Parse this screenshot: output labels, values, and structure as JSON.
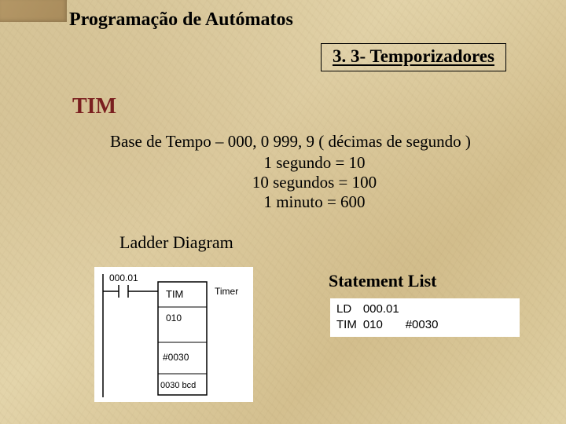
{
  "header": {
    "title": "Programação de Autómatos",
    "subtitle": "3. 3- Temporizadores"
  },
  "section": {
    "mnemonic": "TIM"
  },
  "base": {
    "line1": "Base de Tempo – 000, 0  999, 9 ( décimas de segundo )",
    "line2": "1 segundo = 10",
    "line3": "10 segundos = 100",
    "line4": "1 minuto = 600"
  },
  "labels": {
    "ladder": "Ladder Diagram",
    "statement_list": "Statement List"
  },
  "ladder": {
    "contact": "000.01",
    "block_title": "TIM",
    "annotation": "Timer",
    "row1": "010",
    "row2": "#0030",
    "row3": "0030 bcd"
  },
  "stlist": {
    "rows": [
      {
        "c0": "LD",
        "c1": "000.01",
        "c2": ""
      },
      {
        "c0": "TIM",
        "c1": "010",
        "c2": "#0030"
      }
    ]
  }
}
